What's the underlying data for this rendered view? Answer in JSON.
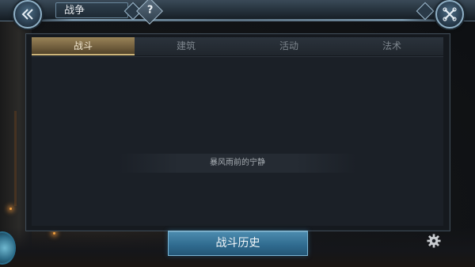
{
  "header": {
    "title": "战争",
    "help_label": "?"
  },
  "tabs": [
    {
      "label": "战斗",
      "active": true
    },
    {
      "label": "建筑",
      "active": false
    },
    {
      "label": "活动",
      "active": false
    },
    {
      "label": "法术",
      "active": false
    }
  ],
  "content": {
    "empty_message": "暴风雨前的宁静"
  },
  "footer": {
    "history_button": "战斗历史"
  },
  "icons": {
    "back": "double-chevron-left-icon",
    "close": "crossed-swords-close-icon",
    "settings": "gear-icon"
  },
  "colors": {
    "accent_tab": "#9a8458",
    "primary_button": "#2f6a8e",
    "panel_bg": "#1b2027"
  }
}
